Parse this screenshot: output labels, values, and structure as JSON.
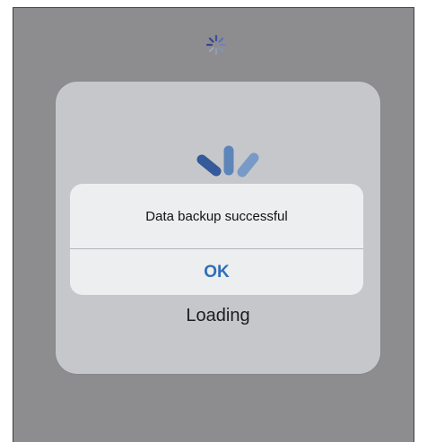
{
  "colors": {
    "backdrop": "#8d8d90",
    "card": "#c6c7ca",
    "alert_bg": "#eeeff0",
    "accent": "#2f6fb5",
    "spinner": "#4a6fa8"
  },
  "top_spinner": {
    "icon": "activity-spinner-icon"
  },
  "loading": {
    "icon": "activity-spinner-icon",
    "label": "Loading"
  },
  "alert": {
    "message": "Data backup successful",
    "ok_label": "OK"
  }
}
